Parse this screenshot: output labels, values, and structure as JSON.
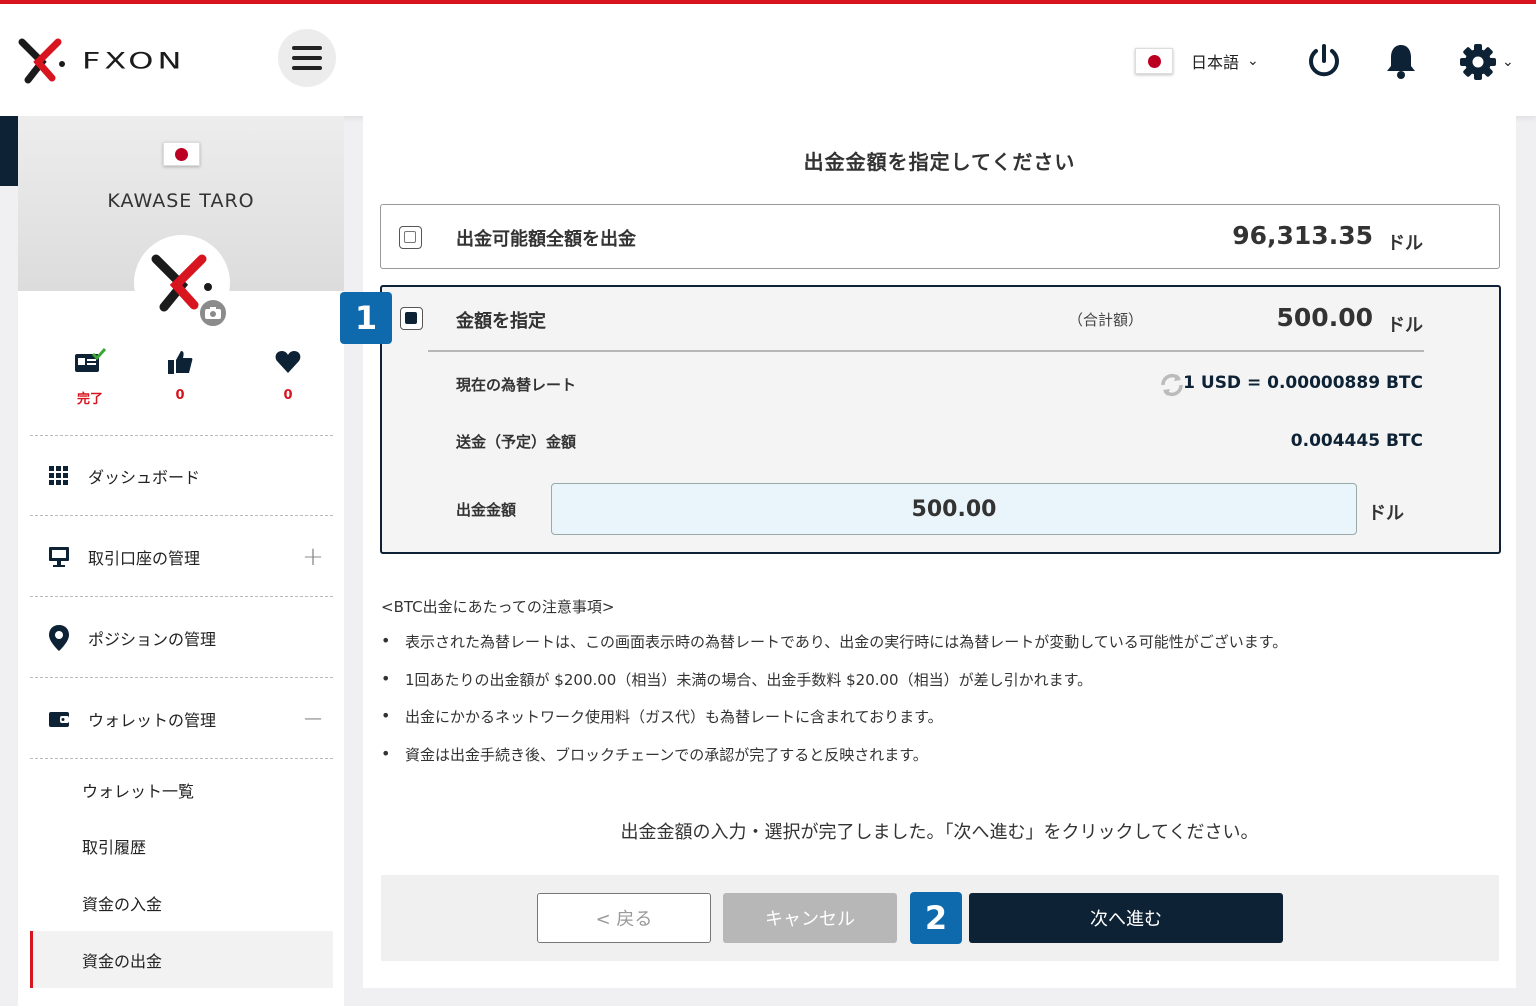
{
  "header": {
    "brand": "FXON",
    "language": "日本語"
  },
  "profile": {
    "name": "KAWASE TARO",
    "stats": [
      {
        "icon": "id-card-check-icon",
        "value": "完了"
      },
      {
        "icon": "thumbs-up-icon",
        "value": "0"
      },
      {
        "icon": "heart-icon",
        "value": "0"
      }
    ]
  },
  "sidebar": {
    "items": [
      {
        "label": "ダッシュボード",
        "icon": "grid-icon"
      },
      {
        "label": "取引口座の管理",
        "icon": "monitor-icon",
        "toggle": "+"
      },
      {
        "label": "ポジションの管理",
        "icon": "map-pin-icon"
      },
      {
        "label": "ウォレットの管理",
        "icon": "wallet-icon",
        "toggle": "−"
      }
    ],
    "subitems": [
      "ウォレット一覧",
      "取引履歴",
      "資金の入金",
      "資金の出金"
    ]
  },
  "main": {
    "title": "出金金額を指定してください",
    "option_all": {
      "label": "出金可能額全額を出金",
      "amount": "96,313.35",
      "unit": "ドル"
    },
    "option_specify": {
      "label": "金額を指定",
      "total_label": "（合計額）",
      "amount": "500.00",
      "unit": "ドル",
      "rate_label": "現在の為替レート",
      "rate_value": "1 USD = 0.00000889 BTC",
      "send_label": "送金（予定）金額",
      "send_value": "0.004445 BTC",
      "input_label": "出金金額",
      "input_value": "500.00",
      "input_unit": "ドル"
    },
    "notes_title": "<BTC出金にあたっての注意事項>",
    "notes": [
      "表示された為替レートは、この画面表示時の為替レートであり、出金の実行時には為替レートが変動している可能性がございます。",
      "1回あたりの出金額が $200.00（相当）未満の場合、出金手数料 $20.00（相当）が差し引かれます。",
      "出金にかかるネットワーク使用料（ガス代）も為替レートに含まれております。",
      "資金は出金手続き後、ブロックチェーンでの承認が完了すると反映されます。"
    ],
    "done_message": "出金金額の入力・選択が完了しました。「次へ進む」をクリックしてください。",
    "buttons": {
      "back": "< 戻る",
      "cancel": "キャンセル",
      "next": "次へ進む"
    },
    "badges": [
      "1",
      "2"
    ]
  },
  "colors": {
    "brand_red": "#d8141f",
    "navy": "#0e2235",
    "badge_blue": "#0e6aad"
  }
}
